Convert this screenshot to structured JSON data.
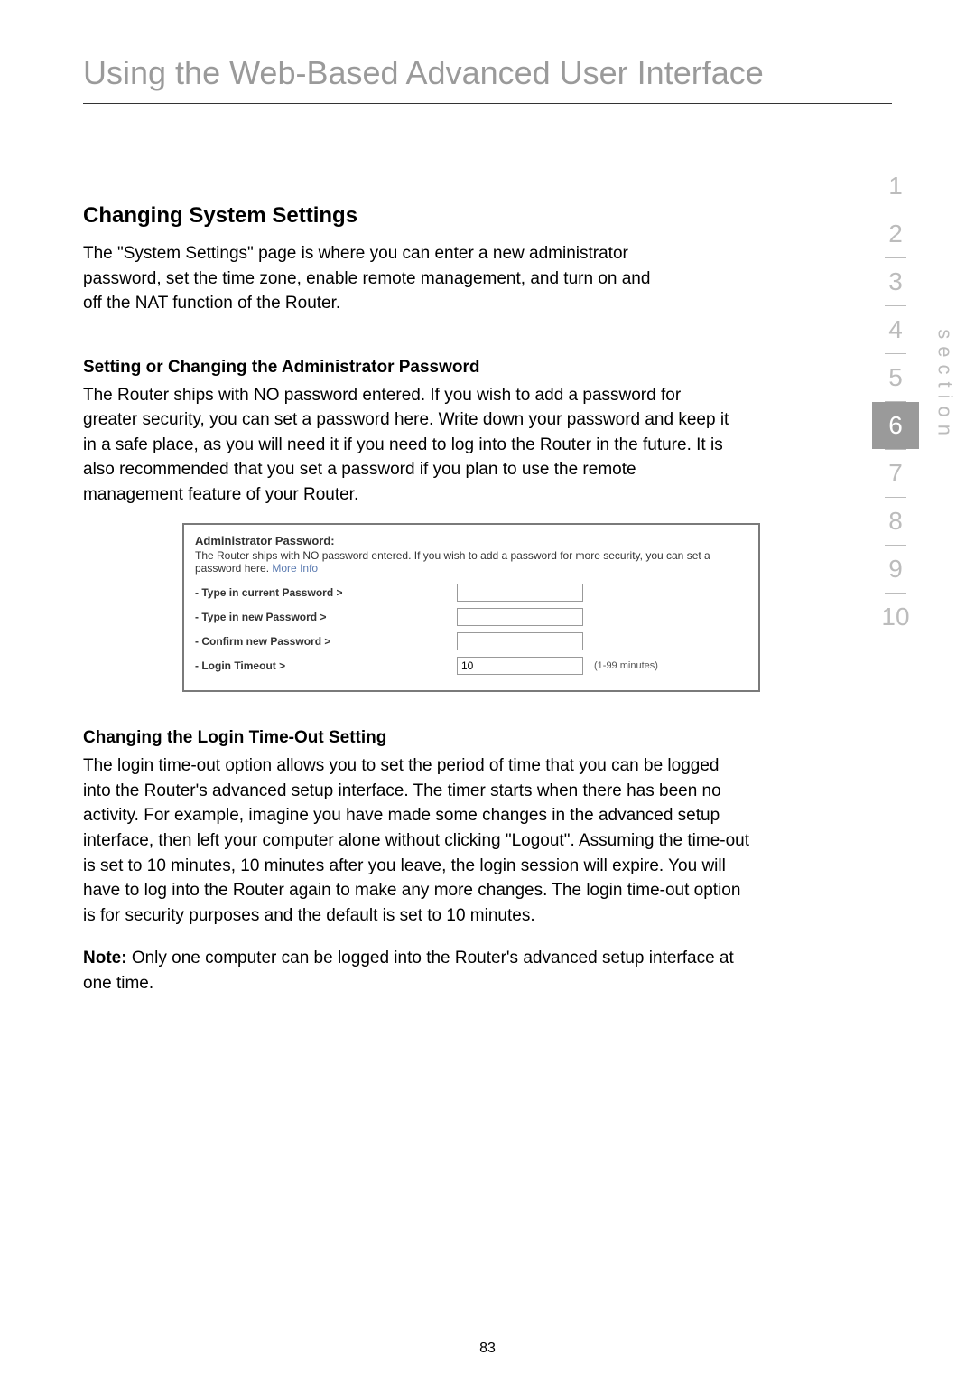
{
  "title": "Using the Web-Based Advanced User Interface",
  "h2": "Changing System Settings",
  "intro": "The \"System Settings\" page is where you can enter a new administrator password, set the time zone, enable remote management, and turn on and off the NAT function of the Router.",
  "section1": {
    "heading": "Setting or Changing the Administrator Password",
    "text": "The Router ships with NO password entered. If you wish to add a password for greater security, you can set a password here. Write down your password and keep it in a safe place, as you will need it if you need to log into the Router in the future. It is also recommended that you set a password if you plan to use the remote management feature of your Router."
  },
  "screenshot": {
    "title": "Administrator Password:",
    "desc": "The Router ships with NO password entered. If you wish to add a password for more security, you can set a password here. ",
    "more_info": "More Info",
    "row1": "- Type in current Password >",
    "row2": "- Type in new Password >",
    "row3": "- Confirm new Password >",
    "row4": "- Login Timeout >",
    "timeout_value": "10",
    "timeout_hint": "(1-99 minutes)"
  },
  "section2": {
    "heading": "Changing the Login Time-Out Setting",
    "text": "The login time-out option allows you to set the period of time that you can be logged into the Router's advanced setup interface. The timer starts when there has been no activity. For example, imagine you have made some changes in the advanced setup interface, then left your computer alone without clicking \"Logout\". Assuming the time-out is set to 10 minutes, 10 minutes after you leave, the login session will expire. You will have to log into the Router again to make any more changes. The login time-out option is for security purposes and the default is set to 10 minutes.",
    "note_label": "Note: ",
    "note_text": "Only one computer can be logged into the Router's advanced setup interface at one time."
  },
  "nav": [
    "1",
    "2",
    "3",
    "4",
    "5",
    "6",
    "7",
    "8",
    "9",
    "10"
  ],
  "nav_active_index": 5,
  "section_word": "section",
  "page_number": "83"
}
